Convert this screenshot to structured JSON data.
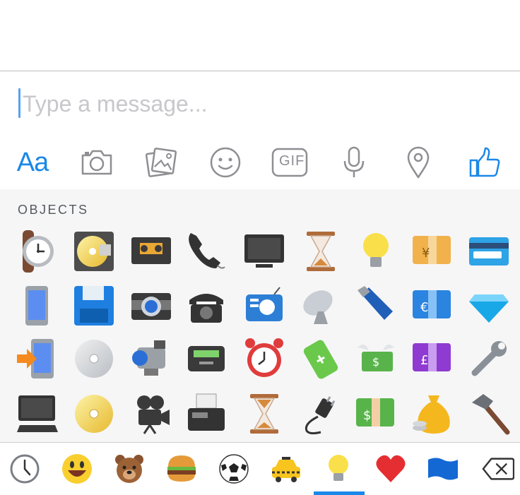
{
  "composer": {
    "placeholder": "Type a message...",
    "value": ""
  },
  "toolbar": {
    "text_button_label": "Aa",
    "gif_label": "GIF",
    "accent_color": "#1a88e8",
    "icons": [
      "text-format",
      "camera-icon",
      "gallery-icon",
      "emoji-icon",
      "gif-icon",
      "microphone-icon",
      "location-pin-icon",
      "thumbs-up-icon"
    ]
  },
  "emoji_picker": {
    "section_title": "OBJECTS",
    "items": [
      "watch",
      "computer-disk",
      "videocassette",
      "telephone-receiver",
      "television",
      "hourglass",
      "light-bulb",
      "banknote-yen",
      "credit-card",
      "mobile-phone",
      "floppy-disk",
      "camera",
      "telephone",
      "radio",
      "satellite-antenna",
      "flashlight",
      "banknote-euro",
      "gem-stone",
      "calling",
      "optical-disk",
      "video-camera",
      "pager",
      "alarm-clock",
      "battery",
      "money-with-wings",
      "banknote-pound",
      "wrench",
      "desktop-computer",
      "dvd",
      "movie-camera",
      "fax-machine",
      "hourglass-flowing",
      "electric-plug",
      "banknote-dollar",
      "money-bag",
      "hammer"
    ]
  },
  "category_tabs": {
    "items": [
      "recent-clock-icon",
      "smileys-icon",
      "animals-icon",
      "food-icon",
      "activity-icon",
      "travel-icon",
      "objects-icon",
      "symbols-icon",
      "flags-icon",
      "backspace-icon"
    ],
    "selected": "objects-icon"
  }
}
